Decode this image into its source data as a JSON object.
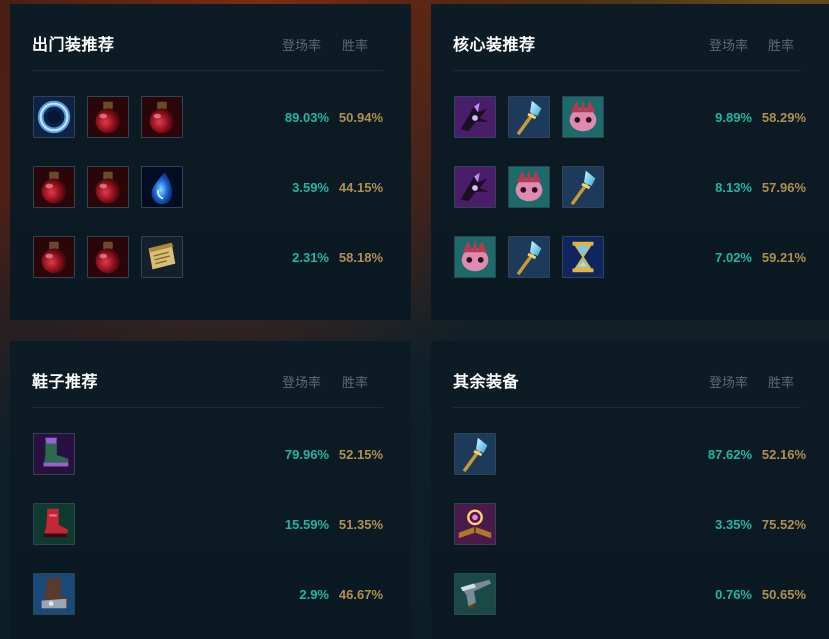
{
  "panels": {
    "start": {
      "title": "出门装推荐",
      "col_pick": "登场率",
      "col_win": "胜率",
      "rows": [
        {
          "icons": [
            "ring-icon",
            "potion-icon",
            "potion-icon"
          ],
          "pick": "89.03%",
          "win": "50.94%"
        },
        {
          "icons": [
            "potion-icon",
            "potion-icon",
            "tear-icon"
          ],
          "pick": "3.59%",
          "win": "44.15%"
        },
        {
          "icons": [
            "potion-icon",
            "potion-icon",
            "scroll-icon"
          ],
          "pick": "2.31%",
          "win": "58.18%"
        }
      ]
    },
    "core": {
      "title": "核心装推荐",
      "col_pick": "登场率",
      "col_win": "胜率",
      "rows": [
        {
          "icons": [
            "dark-claw-icon",
            "crystal-scepter-icon",
            "pink-mask-icon"
          ],
          "pick": "9.89%",
          "win": "58.29%"
        },
        {
          "icons": [
            "dark-claw-icon",
            "pink-mask-icon",
            "crystal-scepter-icon"
          ],
          "pick": "8.13%",
          "win": "57.96%"
        },
        {
          "icons": [
            "pink-mask-icon",
            "crystal-scepter-icon",
            "hourglass-icon"
          ],
          "pick": "7.02%",
          "win": "59.21%"
        }
      ]
    },
    "shoes": {
      "title": "鞋子推荐",
      "col_pick": "登场率",
      "col_win": "胜率",
      "rows": [
        {
          "icons": [
            "sorcerer-boots-icon"
          ],
          "pick": "79.96%",
          "win": "52.15%"
        },
        {
          "icons": [
            "red-boots-icon"
          ],
          "pick": "15.59%",
          "win": "51.35%"
        },
        {
          "icons": [
            "armored-boots-icon"
          ],
          "pick": "2.9%",
          "win": "46.67%"
        }
      ]
    },
    "other": {
      "title": "其余装备",
      "col_pick": "登场率",
      "col_win": "胜率",
      "rows": [
        {
          "icons": [
            "crystal-scepter-icon"
          ],
          "pick": "87.62%",
          "win": "52.16%"
        },
        {
          "icons": [
            "spellbook-icon"
          ],
          "pick": "3.35%",
          "win": "75.52%"
        },
        {
          "icons": [
            "gunblade-icon"
          ],
          "pick": "0.76%",
          "win": "50.65%"
        }
      ]
    }
  },
  "colors": {
    "pick": "#1fb6a4",
    "win": "#b08f52",
    "header": "#5c6a72",
    "panel": "#0c1b24"
  }
}
